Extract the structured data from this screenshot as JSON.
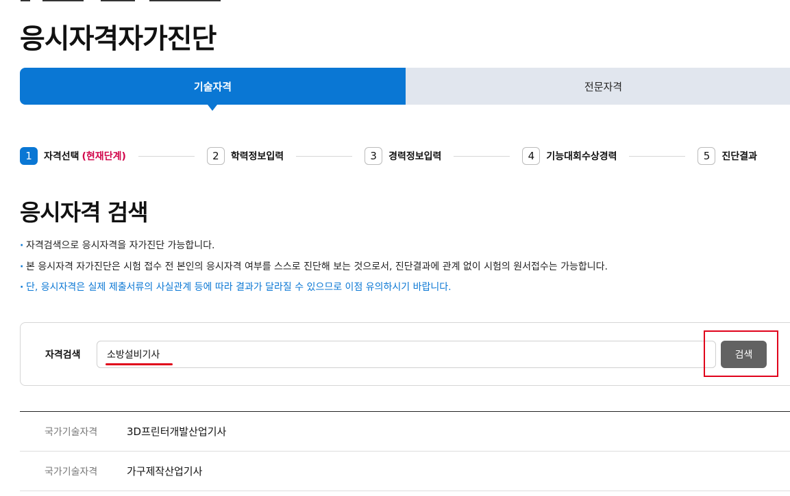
{
  "page": {
    "title": "응시자격자가진단"
  },
  "tabs": [
    {
      "label": "기술자격",
      "active": true
    },
    {
      "label": "전문자격",
      "active": false
    }
  ],
  "steps": [
    {
      "num": "1",
      "label": "자격선택",
      "current_tag": "(현재단계)",
      "active": true
    },
    {
      "num": "2",
      "label": "학력정보입력"
    },
    {
      "num": "3",
      "label": "경력정보입력"
    },
    {
      "num": "4",
      "label": "기능대회수상경력"
    },
    {
      "num": "5",
      "label": "진단결과"
    }
  ],
  "section": {
    "title": "응시자격 검색",
    "notes": [
      "자격검색으로 응시자격을 자가진단 가능합니다.",
      "본 응시자격 자가진단은 시험 접수 전 본인의 응시자격 여부를 스스로 진단해 보는 것으로서, 진단결과에 관계 없이 시험의 원서접수는 가능합니다.",
      "단, 응시자격은 실제 제출서류의 사실관계 등에 따라 결과가 달라질 수 있으므로 이점 유의하시기 바랍니다."
    ]
  },
  "search": {
    "label": "자격검색",
    "value": "소방설비기사",
    "button_label": "검색"
  },
  "results": [
    {
      "category": "국가기술자격",
      "name": "3D프린터개발산업기사"
    },
    {
      "category": "국가기술자격",
      "name": "가구제작산업기사"
    }
  ],
  "colors": {
    "primary": "#0a77d4",
    "current_step": "#d1054a",
    "highlight": "#e0001a",
    "button": "#626262"
  }
}
